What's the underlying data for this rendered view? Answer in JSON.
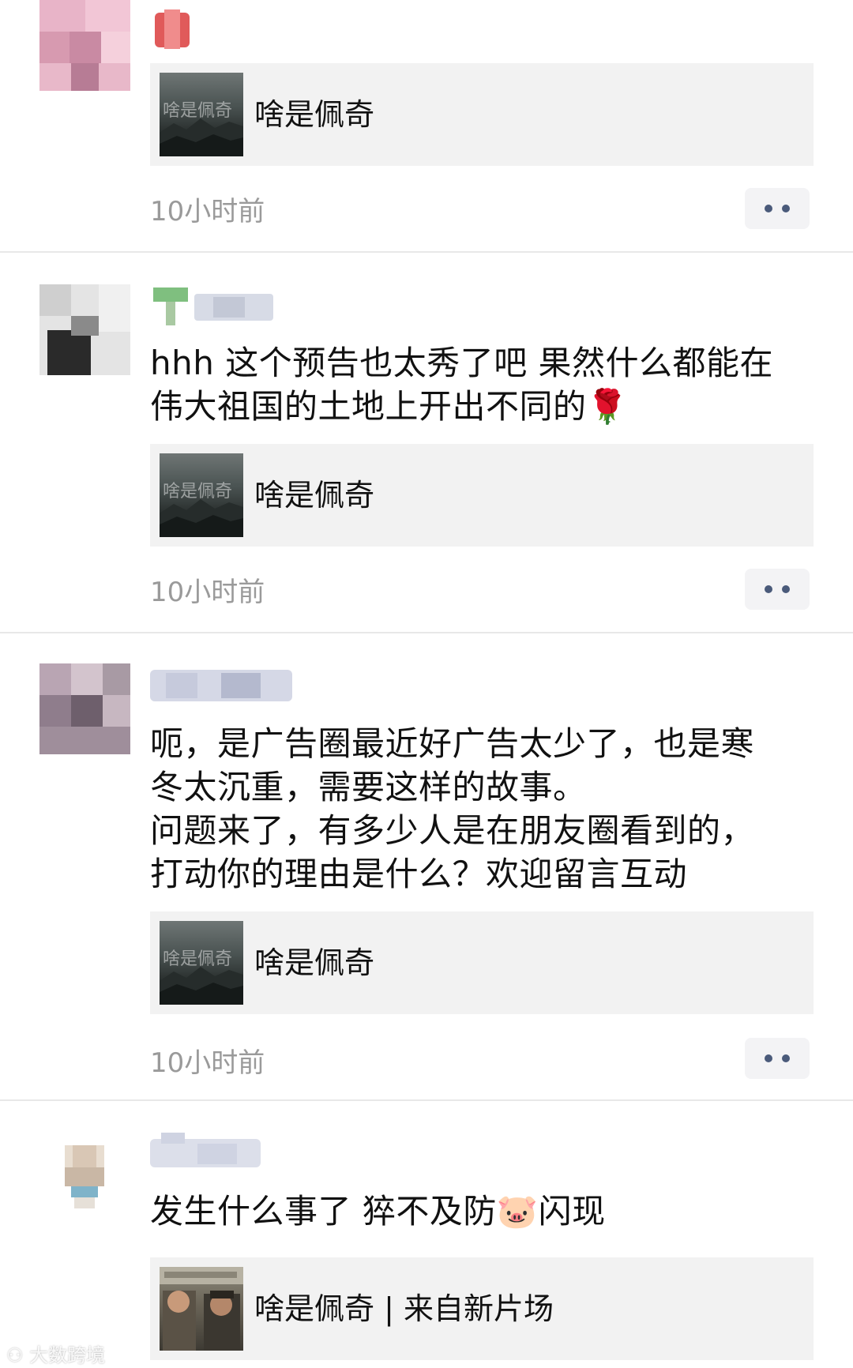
{
  "posts": [
    {
      "text": "",
      "share_title": "啥是佩奇",
      "thumb_overlay_text": "啥是佩奇",
      "time": "10小时前",
      "colors": {
        "avatar": [
          "#e8b4c8",
          "#f2c6d6",
          "#d79ab0",
          "#c98aa3",
          "#f5d0dc",
          "#b77c95"
        ],
        "name": [
          "#e05a5a",
          "#f08c8c"
        ]
      }
    },
    {
      "text": "hhh 这个预告也太秀了吧 果然什么都能在\n伟大祖国的土地上开出不同的🌹",
      "share_title": "啥是佩奇",
      "thumb_overlay_text": "啥是佩奇",
      "time": "10小时前",
      "colors": {
        "avatar": [
          "#d8d8d8",
          "#bdbdbd",
          "#e6e6e6",
          "#2a2a2a",
          "#8a8a8a",
          "#f0f0f0"
        ],
        "name": [
          "#7fbf7f",
          "#d7dbe6",
          "#c3c8d6"
        ]
      }
    },
    {
      "text": "呃，是广告圈最近好广告太少了，也是寒\n冬太沉重，需要这样的故事。\n问题来了，有多少人是在朋友圈看到的，\n打动你的理由是什么？欢迎留言互动",
      "share_title": "啥是佩奇",
      "thumb_overlay_text": "啥是佩奇",
      "time": "10小时前",
      "colors": {
        "avatar": [
          "#b9a5b3",
          "#8f7d8c",
          "#d3c4cd",
          "#6e5f6c",
          "#a89aa4",
          "#c7b7c1"
        ],
        "name": [
          "#c6cadc",
          "#b4b9ce",
          "#d5d8e6"
        ]
      }
    },
    {
      "text": "发生什么事了 猝不及防🐷闪现",
      "share_title": "啥是佩奇 | 来自新片场",
      "thumb_overlay_text": "",
      "time": "",
      "colors": {
        "avatar": [
          "#d9c7b5",
          "#e8ddd0",
          "#7fb3c9",
          "#c9b7a5"
        ],
        "name": [
          "#cfd3e2",
          "#dcdfea"
        ]
      }
    }
  ],
  "watermark": "大数跨境"
}
